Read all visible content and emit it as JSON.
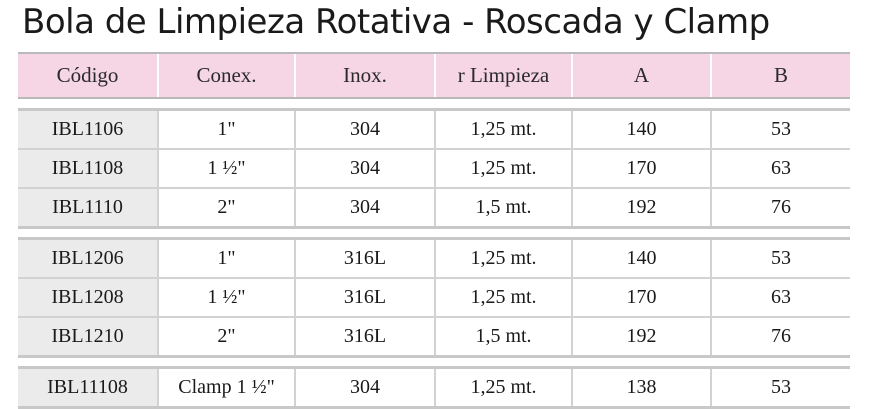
{
  "title": "Bola de Limpieza Rotativa - Roscada y Clamp",
  "headers": [
    "Código",
    "Conex.",
    "Inox.",
    "r Limpieza",
    "A",
    "B"
  ],
  "groups": [
    {
      "rows": [
        {
          "codigo": "IBL1106",
          "conex": "1\"",
          "inox": "304",
          "limpieza": "1,25 mt.",
          "a": "140",
          "b": "53"
        },
        {
          "codigo": "IBL1108",
          "conex": "1 ½\"",
          "inox": "304",
          "limpieza": "1,25 mt.",
          "a": "170",
          "b": "63"
        },
        {
          "codigo": "IBL1110",
          "conex": "2\"",
          "inox": "304",
          "limpieza": "1,5 mt.",
          "a": "192",
          "b": "76"
        }
      ]
    },
    {
      "rows": [
        {
          "codigo": "IBL1206",
          "conex": "1\"",
          "inox": "316L",
          "limpieza": "1,25 mt.",
          "a": "140",
          "b": "53"
        },
        {
          "codigo": "IBL1208",
          "conex": "1 ½\"",
          "inox": "316L",
          "limpieza": "1,25 mt.",
          "a": "170",
          "b": "63"
        },
        {
          "codigo": "IBL1210",
          "conex": "2\"",
          "inox": "316L",
          "limpieza": "1,5 mt.",
          "a": "192",
          "b": "76"
        }
      ]
    },
    {
      "rows": [
        {
          "codigo": "IBL11108",
          "conex": "Clamp 1 ½\"",
          "inox": "304",
          "limpieza": "1,25 mt.",
          "a": "138",
          "b": "53"
        }
      ]
    }
  ],
  "colors": {
    "header_bg": "#f6d5e5",
    "code_cell_bg": "#ebebeb",
    "rule": "#c8c8c8"
  }
}
